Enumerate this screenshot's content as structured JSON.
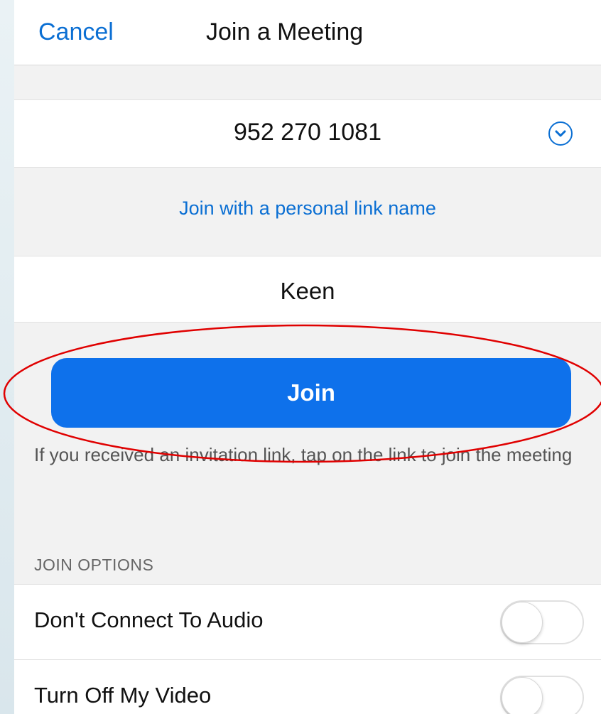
{
  "header": {
    "cancel_label": "Cancel",
    "title": "Join a Meeting"
  },
  "meeting": {
    "id_value": "952 270 1081",
    "dropdown_icon": "chevron-down-circle-icon"
  },
  "personal_link": {
    "label": "Join with a personal link name"
  },
  "name_field": {
    "value": "Keen"
  },
  "join_button": {
    "label": "Join",
    "color": "#0e71eb"
  },
  "hint": {
    "text": "If you received an invitation link, tap on the link to join the meeting"
  },
  "join_options": {
    "header": "JOIN OPTIONS",
    "items": [
      {
        "label": "Don't Connect To Audio",
        "enabled": false
      },
      {
        "label": "Turn Off My Video",
        "enabled": false
      }
    ]
  },
  "colors": {
    "accent": "#0b6fd3",
    "annotation": "#e00000"
  }
}
